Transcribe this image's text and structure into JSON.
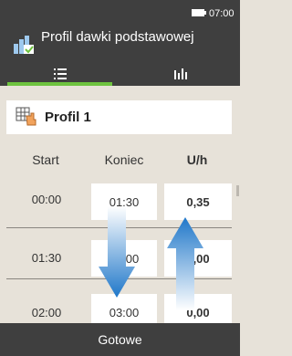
{
  "status": {
    "time": "07:00"
  },
  "header": {
    "title": "Profil dawki podstawowej",
    "icon": "basal-profile-icon"
  },
  "tabs": [
    {
      "icon": "list-icon",
      "selected": true
    },
    {
      "icon": "bar-chart-icon",
      "selected": false
    }
  ],
  "profile": {
    "name": "Profil 1",
    "icon": "profile-grid-icon"
  },
  "table": {
    "headers": {
      "start": "Start",
      "end": "Koniec",
      "rate": "U/h"
    },
    "rows": [
      {
        "start": "00:00",
        "end": "01:30",
        "rate": "0,35"
      },
      {
        "start": "01:30",
        "end": "03:00",
        "rate": "0,00"
      },
      {
        "start": "02:00",
        "end": "03:00",
        "rate": "0,00"
      }
    ]
  },
  "footer": {
    "done_label": "Gotowe"
  },
  "colors": {
    "bar": "#3f3f3f",
    "background": "#e7e2d9",
    "accent": "#6ec33f",
    "arrow": "#1f77c9"
  }
}
